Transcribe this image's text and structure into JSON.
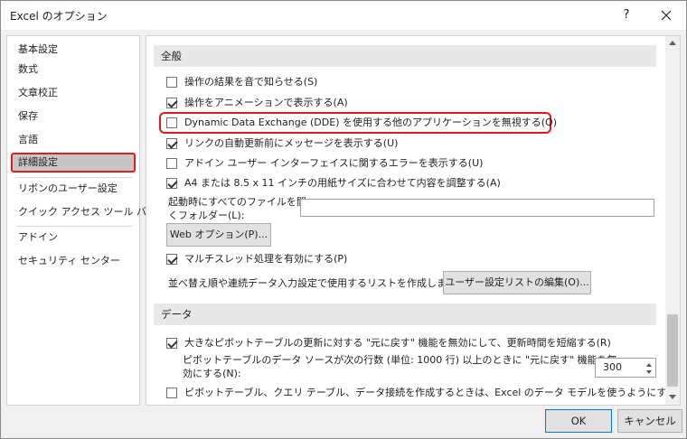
{
  "window": {
    "title": "Excel のオプション",
    "help_glyph": "?",
    "close_icon": "close-icon"
  },
  "sidebar": {
    "items": [
      {
        "label": "基本設定"
      },
      {
        "label": "数式"
      },
      {
        "label": "文章校正"
      },
      {
        "label": "保存"
      },
      {
        "label": "言語"
      },
      {
        "label": "詳細設定",
        "selected": true
      },
      {
        "label": "リボンのユーザー設定"
      },
      {
        "label": "クイック アクセス ツール バー"
      },
      {
        "label": "アドイン"
      },
      {
        "label": "セキュリティ センター"
      }
    ]
  },
  "general": {
    "heading": "全般",
    "options": [
      {
        "label": "操作の結果を音で知らせる(S)",
        "checked": false
      },
      {
        "label": "操作をアニメーションで表示する(A)",
        "checked": true
      },
      {
        "label": "Dynamic Data Exchange (DDE) を使用する他のアプリケーションを無視する(O)",
        "checked": false
      },
      {
        "label": "リンクの自動更新前にメッセージを表示する(U)",
        "checked": true
      },
      {
        "label": "アドイン ユーザー インターフェイスに関するエラーを表示する(U)",
        "checked": false
      },
      {
        "label": "A4 または 8.5 x 11 インチの用紙サイズに合わせて内容を調整する(A)",
        "checked": true
      }
    ],
    "startup_label_1": "起動時にすべてのファイルを開",
    "startup_label_2": "くフォルダー(L):",
    "startup_value": "",
    "web_options_button": "Web オプション(P)...",
    "multithread_label": "マルチスレッド処理を有効にする(P)",
    "multithread_checked": true,
    "sort_list_label": "並べ替え順や連続データ入力設定で使用するリストを作成します:",
    "edit_lists_button": "ユーザー設定リストの編集(O)..."
  },
  "data": {
    "heading": "データ",
    "undo_large_label": "大きなピボットテーブルの更新に対する \"元に戻す\" 機能を無効にして、更新時間を短縮する(R)",
    "undo_large_checked": true,
    "rows_label_1": "ピボットテーブルのデータ ソースが次の行数 (単位: 1000 行) 以上のときに \"元に戻す\" 機能を無",
    "rows_label_2": "効にする(N):",
    "rows_value": "300",
    "data_model_label": "ピボットテーブル、クエリ テーブル、データ接続を作成するときは、Excel のデータ モデルを使うようにする(M)",
    "data_model_checked": false,
    "info_glyph": "i"
  },
  "footer": {
    "ok": "OK",
    "cancel": "キャンセル"
  }
}
